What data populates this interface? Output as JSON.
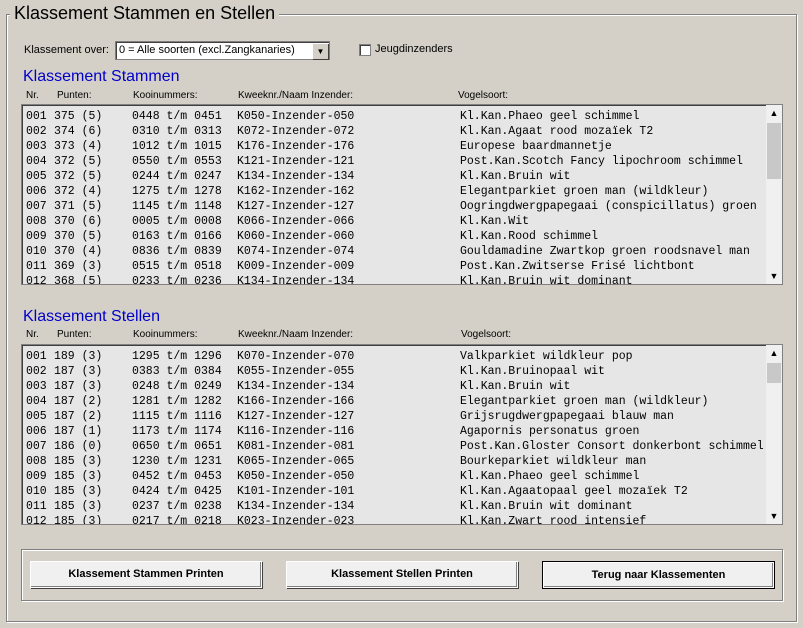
{
  "window_title": "Klassement Stammen en Stellen",
  "filter": {
    "label": "Klassement over:",
    "selected": "0 = Alle soorten (excl.Zangkanaries)",
    "jeugd_label": "Jeugdinzenders",
    "jeugd_checked": false
  },
  "stammen": {
    "title": "Klassement Stammen",
    "headers": {
      "nr": "Nr.",
      "punten": "Punten:",
      "kooi": "Kooinummers:",
      "kweek": "Kweeknr./Naam Inzender:",
      "vogel": "Vogelsoort:"
    },
    "rows": [
      {
        "nr": "001",
        "pt": "375 (5)",
        "kooi": "0448 t/m 0451",
        "kw": "K050-Inzender-050",
        "vs": "Kl.Kan.Phaeo geel schimmel"
      },
      {
        "nr": "002",
        "pt": "374 (6)",
        "kooi": "0310 t/m 0313",
        "kw": "K072-Inzender-072",
        "vs": "Kl.Kan.Agaat rood mozaïek T2"
      },
      {
        "nr": "003",
        "pt": "373 (4)",
        "kooi": "1012 t/m 1015",
        "kw": "K176-Inzender-176",
        "vs": "Europese baardmannetje"
      },
      {
        "nr": "004",
        "pt": "372 (5)",
        "kooi": "0550 t/m 0553",
        "kw": "K121-Inzender-121",
        "vs": "Post.Kan.Scotch Fancy lipochroom schimmel"
      },
      {
        "nr": "005",
        "pt": "372 (5)",
        "kooi": "0244 t/m 0247",
        "kw": "K134-Inzender-134",
        "vs": "Kl.Kan.Bruin wit"
      },
      {
        "nr": "006",
        "pt": "372 (4)",
        "kooi": "1275 t/m 1278",
        "kw": "K162-Inzender-162",
        "vs": "Elegantparkiet groen man (wildkleur)"
      },
      {
        "nr": "007",
        "pt": "371 (5)",
        "kooi": "1145 t/m 1148",
        "kw": "K127-Inzender-127",
        "vs": "Oogringdwergpapegaai (conspicillatus) groen"
      },
      {
        "nr": "008",
        "pt": "370 (6)",
        "kooi": "0005 t/m 0008",
        "kw": "K066-Inzender-066",
        "vs": "Kl.Kan.Wit"
      },
      {
        "nr": "009",
        "pt": "370 (5)",
        "kooi": "0163 t/m 0166",
        "kw": "K060-Inzender-060",
        "vs": "Kl.Kan.Rood schimmel"
      },
      {
        "nr": "010",
        "pt": "370 (4)",
        "kooi": "0836 t/m 0839",
        "kw": "K074-Inzender-074",
        "vs": "Gouldamadine Zwartkop groen roodsnavel man"
      },
      {
        "nr": "011",
        "pt": "369 (3)",
        "kooi": "0515 t/m 0518",
        "kw": "K009-Inzender-009",
        "vs": "Post.Kan.Zwitserse Frisé lichtbont"
      },
      {
        "nr": "012",
        "pt": "368 (5)",
        "kooi": "0233 t/m 0236",
        "kw": "K134-Inzender-134",
        "vs": "Kl.Kan.Bruin wit dominant"
      }
    ]
  },
  "stellen": {
    "title": "Klassement Stellen",
    "headers": {
      "nr": "Nr.",
      "punten": "Punten:",
      "kooi": "Kooinummers:",
      "kweek": "Kweeknr./Naam Inzender:",
      "vogel": "Vogelsoort:"
    },
    "rows": [
      {
        "nr": "001",
        "pt": "189 (3)",
        "kooi": "1295 t/m 1296",
        "kw": "K070-Inzender-070",
        "vs": "Valkparkiet wildkleur pop"
      },
      {
        "nr": "002",
        "pt": "187 (3)",
        "kooi": "0383 t/m 0384",
        "kw": "K055-Inzender-055",
        "vs": "Kl.Kan.Bruinopaal wit"
      },
      {
        "nr": "003",
        "pt": "187 (3)",
        "kooi": "0248 t/m 0249",
        "kw": "K134-Inzender-134",
        "vs": "Kl.Kan.Bruin wit"
      },
      {
        "nr": "004",
        "pt": "187 (2)",
        "kooi": "1281 t/m 1282",
        "kw": "K166-Inzender-166",
        "vs": "Elegantparkiet groen man (wildkleur)"
      },
      {
        "nr": "005",
        "pt": "187 (2)",
        "kooi": "1115 t/m 1116",
        "kw": "K127-Inzender-127",
        "vs": "Grijsrugdwergpapegaai blauw man"
      },
      {
        "nr": "006",
        "pt": "187 (1)",
        "kooi": "1173 t/m 1174",
        "kw": "K116-Inzender-116",
        "vs": "Agapornis personatus groen"
      },
      {
        "nr": "007",
        "pt": "186 (0)",
        "kooi": "0650 t/m 0651",
        "kw": "K081-Inzender-081",
        "vs": "Post.Kan.Gloster Consort donkerbont schimmel"
      },
      {
        "nr": "008",
        "pt": "185 (3)",
        "kooi": "1230 t/m 1231",
        "kw": "K065-Inzender-065",
        "vs": "Bourkeparkiet wildkleur man"
      },
      {
        "nr": "009",
        "pt": "185 (3)",
        "kooi": "0452 t/m 0453",
        "kw": "K050-Inzender-050",
        "vs": "Kl.Kan.Phaeo geel schimmel"
      },
      {
        "nr": "010",
        "pt": "185 (3)",
        "kooi": "0424 t/m 0425",
        "kw": "K101-Inzender-101",
        "vs": "Kl.Kan.Agaatopaal geel mozaïek T2"
      },
      {
        "nr": "011",
        "pt": "185 (3)",
        "kooi": "0237 t/m 0238",
        "kw": "K134-Inzender-134",
        "vs": "Kl.Kan.Bruin wit dominant"
      },
      {
        "nr": "012",
        "pt": "185 (3)",
        "kooi": "0217 t/m 0218",
        "kw": "K023-Inzender-023",
        "vs": "Kl.Kan.Zwart rood intensief"
      }
    ]
  },
  "buttons": {
    "print_stammen": "Klassement Stammen Printen",
    "print_stellen": "Klassement Stellen Printen",
    "back": "Terug naar Klassementen"
  },
  "icons": {
    "dropdown": "chevron-down-icon",
    "scroll_up": "arrow-up-icon",
    "scroll_down": "arrow-down-icon"
  }
}
